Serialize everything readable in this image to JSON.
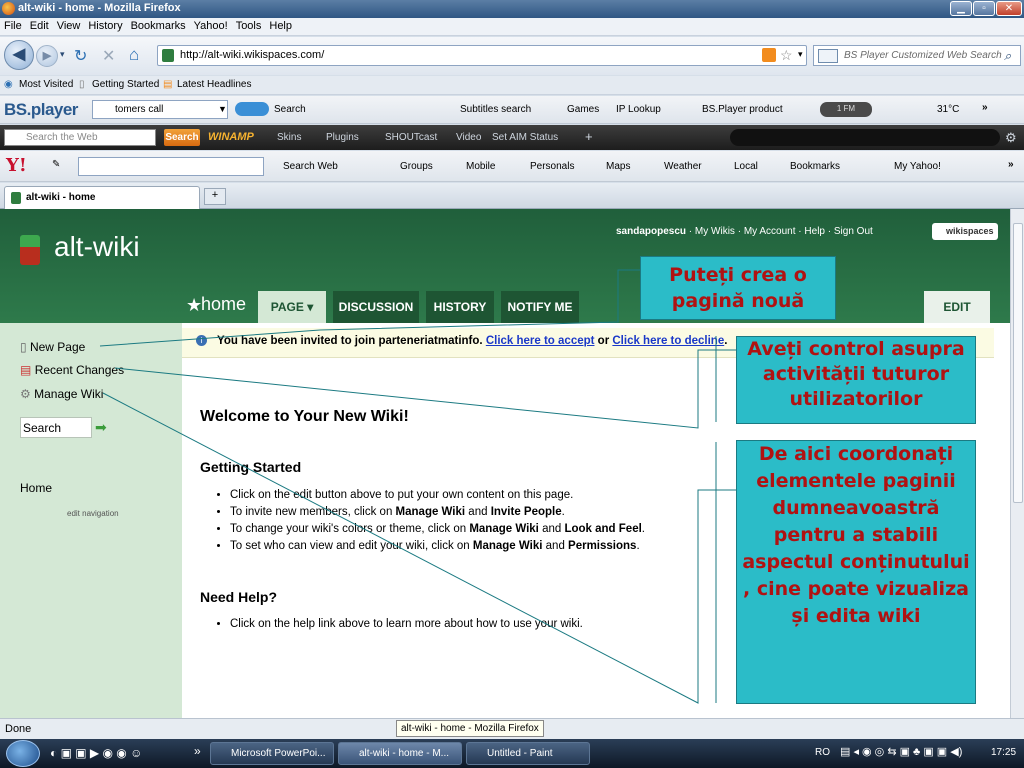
{
  "window": {
    "title": "alt-wiki - home - Mozilla Firefox"
  },
  "menubar": [
    "File",
    "Edit",
    "View",
    "History",
    "Bookmarks",
    "Yahoo!",
    "Tools",
    "Help"
  ],
  "nav": {
    "url": "http://alt-wiki.wikispaces.com/",
    "search_placeholder": "BS Player Customized Web Search"
  },
  "bookmarks": [
    "Most Visited",
    "Getting Started",
    "Latest Headlines"
  ],
  "bsplayer_toolbar": {
    "logo": "BS.player",
    "search_value": "tomers call",
    "items": [
      "Search",
      "Subtitles search",
      "Games",
      "IP Lookup",
      "BS.Player product",
      "1 FM",
      "31°C"
    ]
  },
  "winamp_toolbar": {
    "search_placeholder": "Search the Web",
    "search_button": "Search",
    "logo": "WINAMP",
    "items": [
      "Skins",
      "Plugins",
      "SHOUTcast",
      "Video",
      "Set AIM Status"
    ]
  },
  "yahoo_toolbar": {
    "logo": "Y!",
    "items": [
      "Search Web",
      "Groups",
      "Mobile",
      "Personals",
      "Maps",
      "Weather",
      "Local",
      "Bookmarks",
      "My Yahoo!"
    ]
  },
  "tabs": [
    {
      "label": "alt-wiki - home"
    }
  ],
  "wiki": {
    "name": "alt-wiki",
    "user_links": [
      "sandapopescu",
      "My Wikis",
      "My Account",
      "Help",
      "Sign Out"
    ],
    "brand": "wikispaces",
    "home_label": "home",
    "tabs": [
      "PAGE",
      "DISCUSSION",
      "HISTORY",
      "NOTIFY ME"
    ],
    "edit_label": "EDIT",
    "sidebar": {
      "items": [
        "New Page",
        "Recent Changes",
        "Manage Wiki"
      ],
      "search_value": "Search",
      "home_link": "Home",
      "edit_nav": "edit navigation"
    },
    "invite": {
      "text": "You have been invited to join parteneriatmatinfo.",
      "accept": "Click here to accept",
      "or": "or",
      "decline": "Click here to decline",
      "period": "."
    },
    "welcome_title": "Welcome to Your New Wiki!",
    "getting_started_title": "Getting Started",
    "getting_started": [
      {
        "pre": "Click on the edit button above to put your own content on this page.",
        "b1": "",
        "mid": "",
        "b2": "",
        "post": ""
      },
      {
        "pre": "To invite new members, click on ",
        "b1": "Manage Wiki",
        "mid": " and ",
        "b2": "Invite People",
        "post": "."
      },
      {
        "pre": "To change your wiki's colors or theme, click on ",
        "b1": "Manage Wiki",
        "mid": " and ",
        "b2": "Look and Feel",
        "post": "."
      },
      {
        "pre": "To set who can view and edit your wiki, click on ",
        "b1": "Manage Wiki",
        "mid": " and ",
        "b2": "Permissions",
        "post": "."
      }
    ],
    "need_help_title": "Need Help?",
    "need_help": "Click on the help link above to learn more about how to use your wiki."
  },
  "annotations": [
    "Puteți crea o pagină nouă",
    "Aveți control asupra activității tuturor utilizatorilor",
    "De aici coordonați elementele paginii dumneavoastră pentru a stabili aspectul conținutului , cine poate vizualiza și edita wiki"
  ],
  "status": {
    "text": "Done",
    "tooltip": "alt-wiki - home - Mozilla Firefox"
  },
  "taskbar": {
    "tasks": [
      "Microsoft PowerPoi...",
      "alt-wiki - home - M...",
      "Untitled - Paint"
    ],
    "lang": "RO",
    "clock": "17:25"
  },
  "colors": {
    "wiki_green": "#2e7a4b",
    "sidebar_green": "#d4e8d5",
    "annotation_bg": "#2bbcc8",
    "annotation_text": "#b01212"
  }
}
